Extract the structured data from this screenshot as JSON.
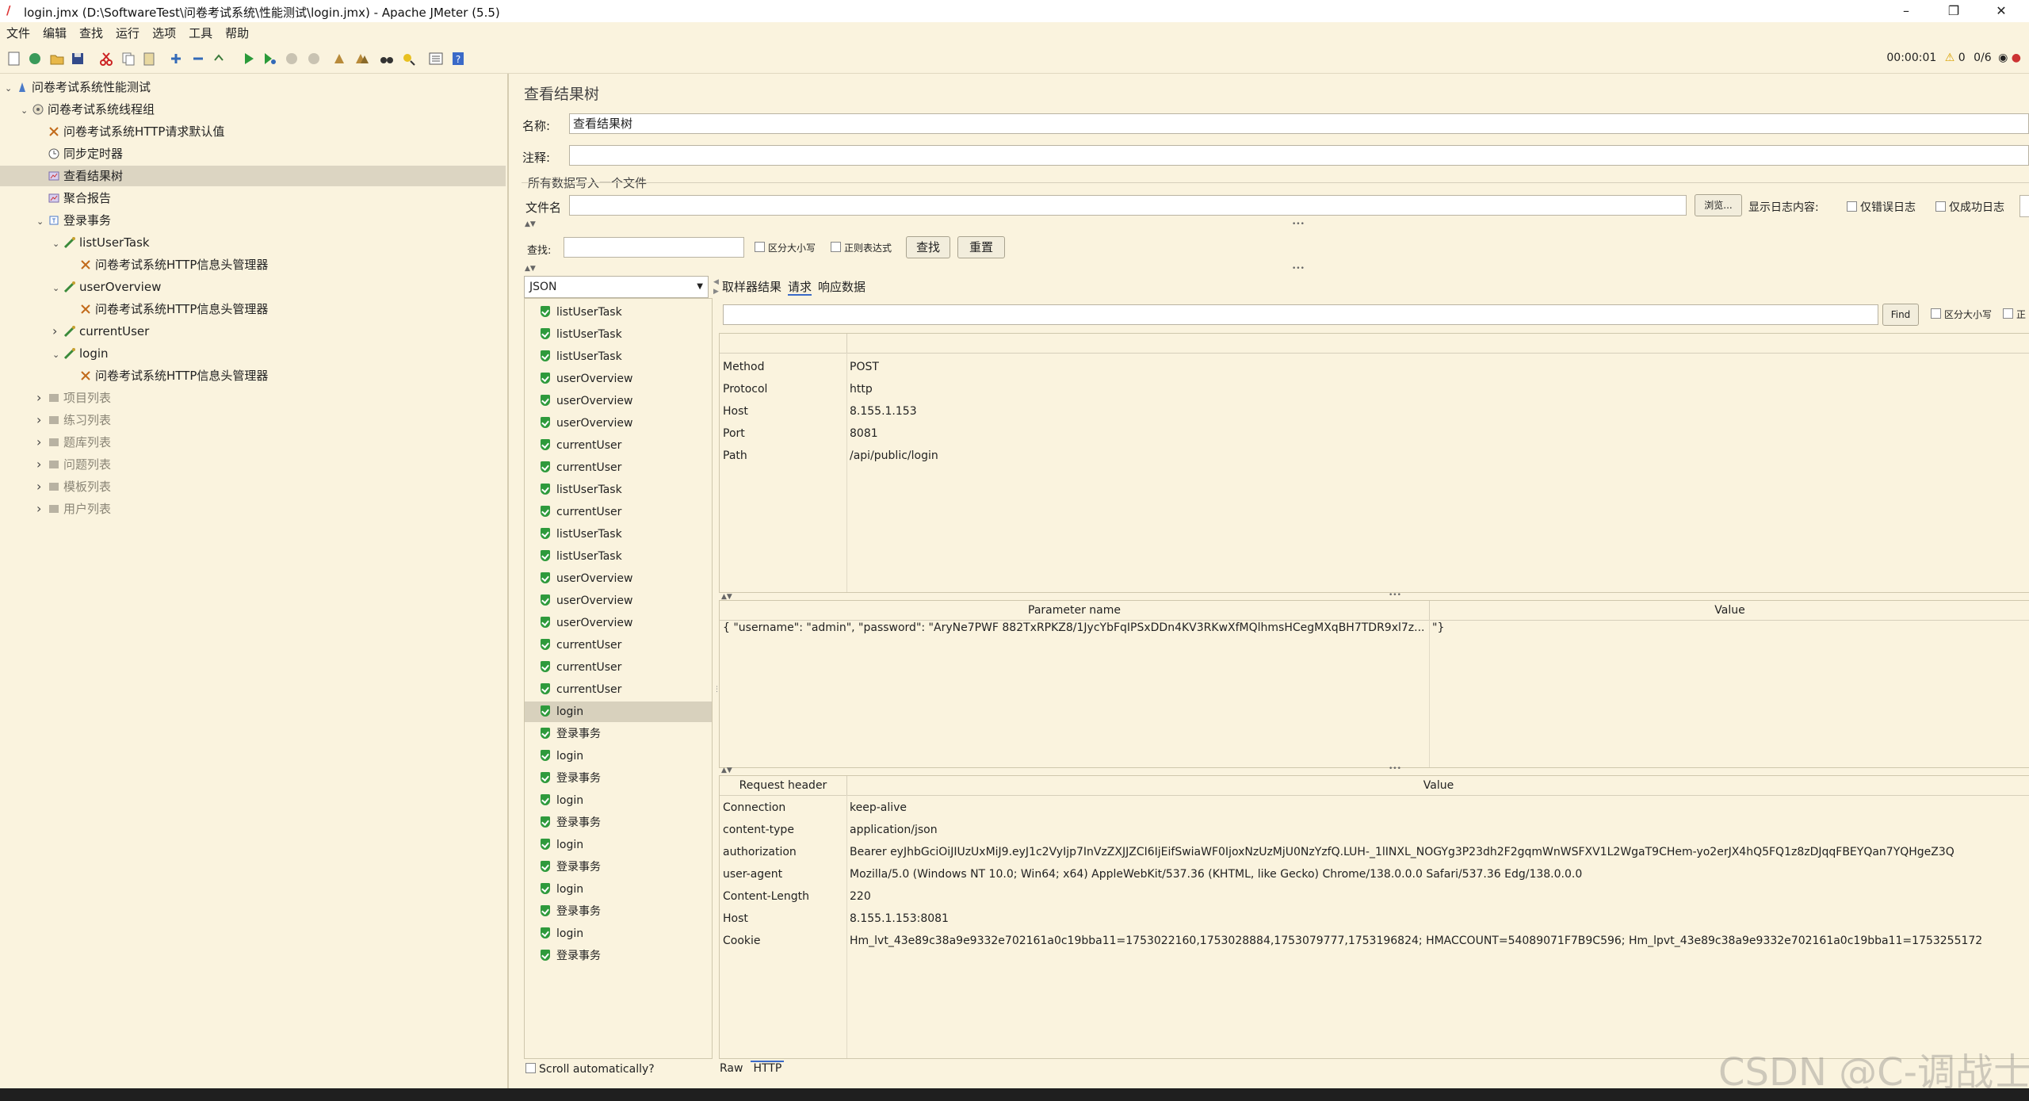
{
  "window": {
    "title": "login.jmx (D:\\SoftwareTest\\问卷考试系统\\性能测试\\login.jmx) - Apache JMeter (5.5)"
  },
  "menu": [
    "文件",
    "编辑",
    "查找",
    "运行",
    "选项",
    "工具",
    "帮助"
  ],
  "status": {
    "elapsed": "00:00:01",
    "warnings": "0",
    "threads": "0/6"
  },
  "tree": [
    {
      "label": "问卷考试系统性能测试",
      "indent": 0,
      "arrow": "v",
      "icon": "testplan-icon"
    },
    {
      "label": "问卷考试系统线程组",
      "indent": 1,
      "arrow": "v",
      "icon": "threadgroup-icon"
    },
    {
      "label": "问卷考试系统HTTP请求默认值",
      "indent": 2,
      "arrow": "",
      "icon": "config-icon"
    },
    {
      "label": "同步定时器",
      "indent": 2,
      "arrow": "",
      "icon": "timer-icon"
    },
    {
      "label": "查看结果树",
      "indent": 2,
      "arrow": "",
      "icon": "listener-icon",
      "selected": true
    },
    {
      "label": "聚合报告",
      "indent": 2,
      "arrow": "",
      "icon": "listener-icon"
    },
    {
      "label": "登录事务",
      "indent": 2,
      "arrow": "v",
      "icon": "transaction-icon"
    },
    {
      "label": "listUserTask",
      "indent": 3,
      "arrow": "v",
      "icon": "sampler-icon"
    },
    {
      "label": "问卷考试系统HTTP信息头管理器",
      "indent": 4,
      "arrow": "",
      "icon": "config-icon"
    },
    {
      "label": "userOverview",
      "indent": 3,
      "arrow": "v",
      "icon": "sampler-icon"
    },
    {
      "label": "问卷考试系统HTTP信息头管理器",
      "indent": 4,
      "arrow": "",
      "icon": "config-icon"
    },
    {
      "label": "currentUser",
      "indent": 3,
      "arrow": ">",
      "icon": "sampler-icon"
    },
    {
      "label": "login",
      "indent": 3,
      "arrow": "v",
      "icon": "sampler-icon"
    },
    {
      "label": "问卷考试系统HTTP信息头管理器",
      "indent": 4,
      "arrow": "",
      "icon": "config-icon"
    },
    {
      "label": "项目列表",
      "indent": 2,
      "arrow": ">",
      "icon": "disabled-icon",
      "disabled": true
    },
    {
      "label": "练习列表",
      "indent": 2,
      "arrow": ">",
      "icon": "disabled-icon",
      "disabled": true
    },
    {
      "label": "题库列表",
      "indent": 2,
      "arrow": ">",
      "icon": "disabled-icon",
      "disabled": true
    },
    {
      "label": "问题列表",
      "indent": 2,
      "arrow": ">",
      "icon": "disabled-icon",
      "disabled": true
    },
    {
      "label": "模板列表",
      "indent": 2,
      "arrow": ">",
      "icon": "disabled-icon",
      "disabled": true
    },
    {
      "label": "用户列表",
      "indent": 2,
      "arrow": ">",
      "icon": "disabled-icon",
      "disabled": true
    }
  ],
  "panel": {
    "title": "查看结果树",
    "name_label": "名称:",
    "name_value": "查看结果树",
    "comment_label": "注释:",
    "file_group": "所有数据写入一个文件",
    "file_label": "文件名",
    "browse": "浏览...",
    "log_label": "显示日志内容:",
    "errors_only": "仅错误日志",
    "success_only": "仅成功日志",
    "search_label": "查找:",
    "case_sensitive": "区分大小写",
    "regex": "正则表达式",
    "search_btn": "查找",
    "reset_btn": "重置",
    "renderer": "JSON",
    "tabs": [
      "取样器结果",
      "请求",
      "响应数据"
    ],
    "find_btn": "Find",
    "find_case": "区分大小写",
    "find_cut": "正",
    "scroll_auto": "Scroll automatically?",
    "bottom_tabs": [
      "Raw",
      "HTTP"
    ]
  },
  "results": [
    "listUserTask",
    "listUserTask",
    "listUserTask",
    "userOverview",
    "userOverview",
    "userOverview",
    "currentUser",
    "currentUser",
    "listUserTask",
    "currentUser",
    "listUserTask",
    "listUserTask",
    "userOverview",
    "userOverview",
    "userOverview",
    "currentUser",
    "currentUser",
    "currentUser",
    "login",
    "登录事务",
    "login",
    "登录事务",
    "login",
    "登录事务",
    "login",
    "登录事务",
    "login",
    "登录事务",
    "login",
    "登录事务"
  ],
  "selected_result": 18,
  "request_info": [
    {
      "key": "Method",
      "value": "POST"
    },
    {
      "key": "Protocol",
      "value": "http"
    },
    {
      "key": "Host",
      "value": "8.155.1.153"
    },
    {
      "key": "Port",
      "value": "8081"
    },
    {
      "key": "Path",
      "value": "/api/public/login"
    }
  ],
  "params": {
    "headers": [
      "Parameter name",
      "Value"
    ],
    "rows": [
      {
        "name": "{  \"username\": \"admin\",  \"password\": \"AryNe7PWF 882TxRPKZ8/1JycYbFqIPSxDDn4KV3RKwXfMQlhmsHCegMXqBH7TDR9xl7z...",
        "value": "\"}"
      }
    ]
  },
  "req_headers": {
    "headers": [
      "Request header",
      "Value"
    ],
    "rows": [
      {
        "key": "Connection",
        "value": "keep-alive"
      },
      {
        "key": "content-type",
        "value": "application/json"
      },
      {
        "key": "authorization",
        "value": "Bearer eyJhbGciOiJIUzUxMiJ9.eyJ1c2VyIjp7InVzZXJJZCI6IjEifSwiaWF0IjoxNzUzMjU0NzYzfQ.LUH-_1lINXL_NOGYg3P23dh2F2gqmWnWSFXV1L2WgaT9CHem-yo2erJX4hQ5FQ1z8zDJqqFBEYQan7YQHgeZ3Q"
      },
      {
        "key": "user-agent",
        "value": "Mozilla/5.0 (Windows NT 10.0; Win64; x64) AppleWebKit/537.36 (KHTML, like Gecko) Chrome/138.0.0.0 Safari/537.36 Edg/138.0.0.0"
      },
      {
        "key": "Content-Length",
        "value": "220"
      },
      {
        "key": "Host",
        "value": "8.155.1.153:8081"
      },
      {
        "key": "Cookie",
        "value": "Hm_lvt_43e89c38a9e9332e702161a0c19bba11=1753022160,1753028884,1753079777,1753196824; HMACCOUNT=54089071F7B9C596; Hm_lpvt_43e89c38a9e9332e702161a0c19bba11=1753255172"
      }
    ]
  },
  "watermark": "CSDN @C-调战士",
  "colors": {
    "ok": "#2e9a3c",
    "bg": "#faf3de",
    "selected": "#dcd5c2"
  }
}
